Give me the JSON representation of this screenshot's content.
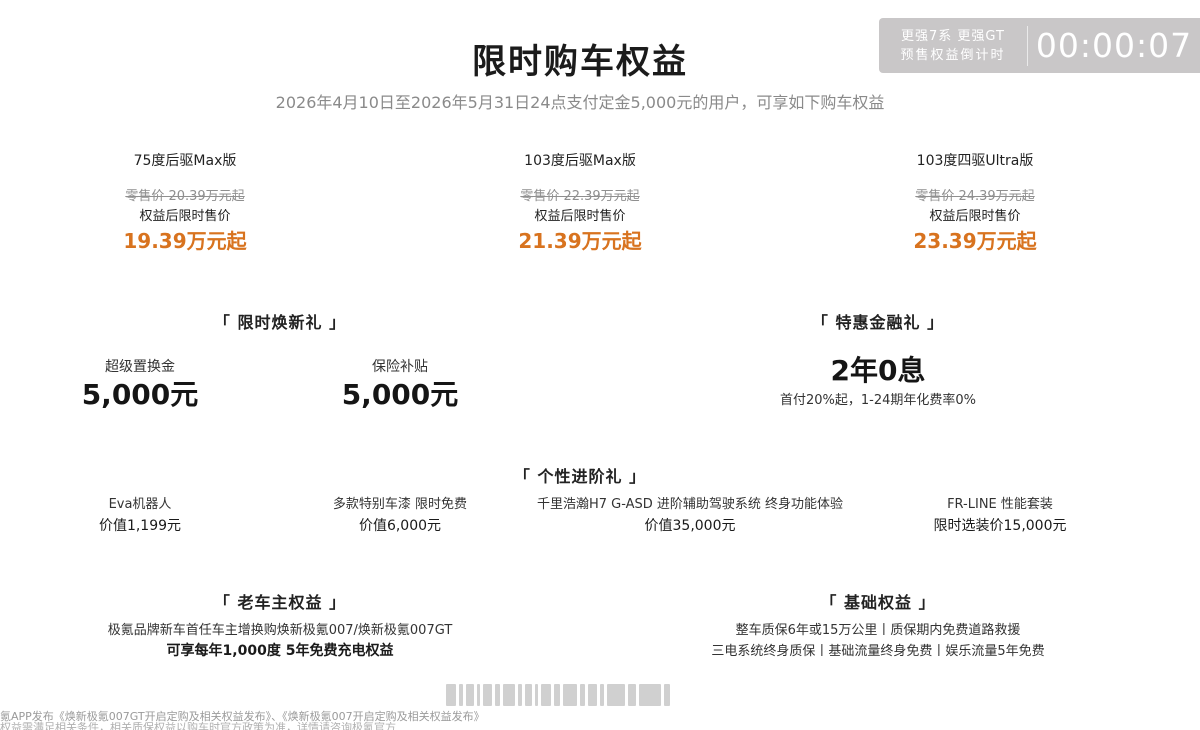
{
  "countdown": {
    "line1": "更强7系 更强GT",
    "line2": "预售权益倒计时",
    "time": "00:00:07"
  },
  "header": {
    "title": "限时购车权益",
    "subtitle": "2026年4月10日至2026年5月31日24点支付定金5,000元的用户，可享如下购车权益"
  },
  "prices": [
    {
      "model": "75度后驱Max版",
      "msrp": "零售价 20.39万元起",
      "after_label": "权益后限时售价",
      "sale": "19.39万元起"
    },
    {
      "model": "103度后驱Max版",
      "msrp": "零售价 22.39万元起",
      "after_label": "权益后限时售价",
      "sale": "21.39万元起"
    },
    {
      "model": "103度四驱Ultra版",
      "msrp": "零售价 24.39万元起",
      "after_label": "权益后限时售价",
      "sale": "23.39万元起"
    }
  ],
  "trade_in": {
    "title": "「 限时焕新礼 」",
    "items": [
      {
        "label": "超级置换金",
        "value": "5,000元"
      },
      {
        "label": "保险补贴",
        "value": "5,000元"
      }
    ]
  },
  "finance": {
    "title": "「 特惠金融礼 」",
    "value": "2年0息",
    "note": "首付20%起，1-24期年化费率0%"
  },
  "upgrade": {
    "title": "「 个性进阶礼 」",
    "items": [
      {
        "label": "Eva机器人",
        "value": "价值1,199元"
      },
      {
        "label": "多款特别车漆 限时免费",
        "value": "价值6,000元"
      },
      {
        "label": "千里浩瀚H7 G-ASD 进阶辅助驾驶系统 终身功能体验",
        "value": "价值35,000元"
      },
      {
        "label": "FR-LINE 性能套装",
        "value": "限时选装价15,000元"
      }
    ]
  },
  "owner": {
    "title": "「 老车主权益 」",
    "line1": "极氪品牌新车首任车主增换购焕新极氪007/焕新极氪007GT",
    "line2": "可享每年1,000度 5年免费充电权益"
  },
  "basic": {
    "title": "「 基础权益 」",
    "line1": "整车质保6年或15万公里丨质保期内免费道路救援",
    "line2": "三电系统终身质保丨基础流量终身免费丨娱乐流量5年免费"
  },
  "footer": {
    "line1": "氪APP发布《焕新极氪007GT开启定购及相关权益发布》、《焕新极氪007开启定购及相关权益发布》",
    "line2": "权益需满足相关条件，相关质保权益以购车时官方政策为准，详情请咨询极氪官方"
  }
}
